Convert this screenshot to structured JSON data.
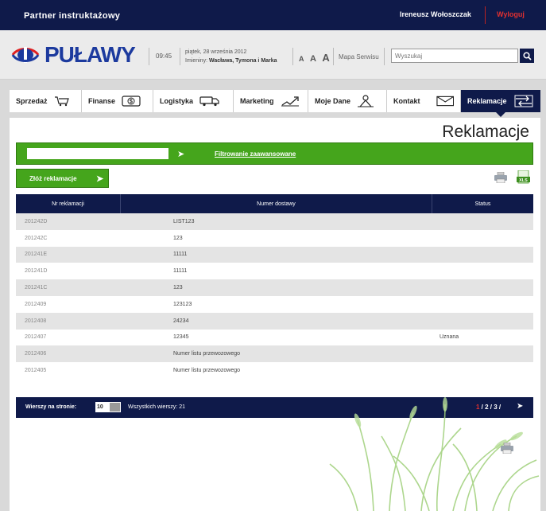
{
  "topbar": {
    "partner": "Partner instruktażowy",
    "user": "Ireneusz Wołoszczak",
    "logout": "Wyloguj"
  },
  "header": {
    "logo_text": "PUŁAWY",
    "time": "09:45",
    "date": "piątek, 28 września 2012",
    "names_label": "Imieniny:",
    "names": "Wacława, Tymona i Marka",
    "font_sizes": [
      "A",
      "A",
      "A"
    ],
    "site_map": "Mapa Serwisu",
    "search_placeholder": "Wyszukaj"
  },
  "nav": [
    {
      "label": "Sprzedaż",
      "icon": "cart-icon"
    },
    {
      "label": "Finanse",
      "icon": "dollar-icon"
    },
    {
      "label": "Logistyka",
      "icon": "truck-icon"
    },
    {
      "label": "Marketing",
      "icon": "chart-up-icon"
    },
    {
      "label": "Moje Dane",
      "icon": "person-icon"
    },
    {
      "label": "Kontakt",
      "icon": "envelope-icon"
    },
    {
      "label": "Reklamacje",
      "icon": "exchange-icon",
      "active": true
    }
  ],
  "main": {
    "title": "Reklamacje",
    "filter_adv": "Filtrowanie zaawansowane",
    "add_button": "Złóż reklamacje",
    "table": {
      "headers": [
        "Nr reklamacji",
        "Numer dostawy",
        "Status"
      ],
      "rows": [
        [
          "201242D",
          "LIST123",
          ""
        ],
        [
          "201242C",
          "123",
          ""
        ],
        [
          "201241E",
          "11111",
          ""
        ],
        [
          "201241D",
          "11111",
          ""
        ],
        [
          "201241C",
          "123",
          ""
        ],
        [
          "2012409",
          "123123",
          ""
        ],
        [
          "2012408",
          "24234",
          ""
        ],
        [
          "2012407",
          "12345",
          "Uznana"
        ],
        [
          "2012406",
          "Numer listu przewozowego",
          ""
        ],
        [
          "2012405",
          "Numer listu przewozowego",
          ""
        ]
      ]
    },
    "footer": {
      "rows_per_page_label": "Wierszy na stronie:",
      "rows_per_page": "10",
      "total_label": "Wszystkich wierszy:",
      "total": "21",
      "pages": [
        "1",
        "2",
        "3"
      ],
      "current_page": "1"
    }
  },
  "colors": {
    "navy": "#0f1a4a",
    "green": "#45a51c",
    "red": "#e03030",
    "brand_blue": "#1c3a9e"
  }
}
